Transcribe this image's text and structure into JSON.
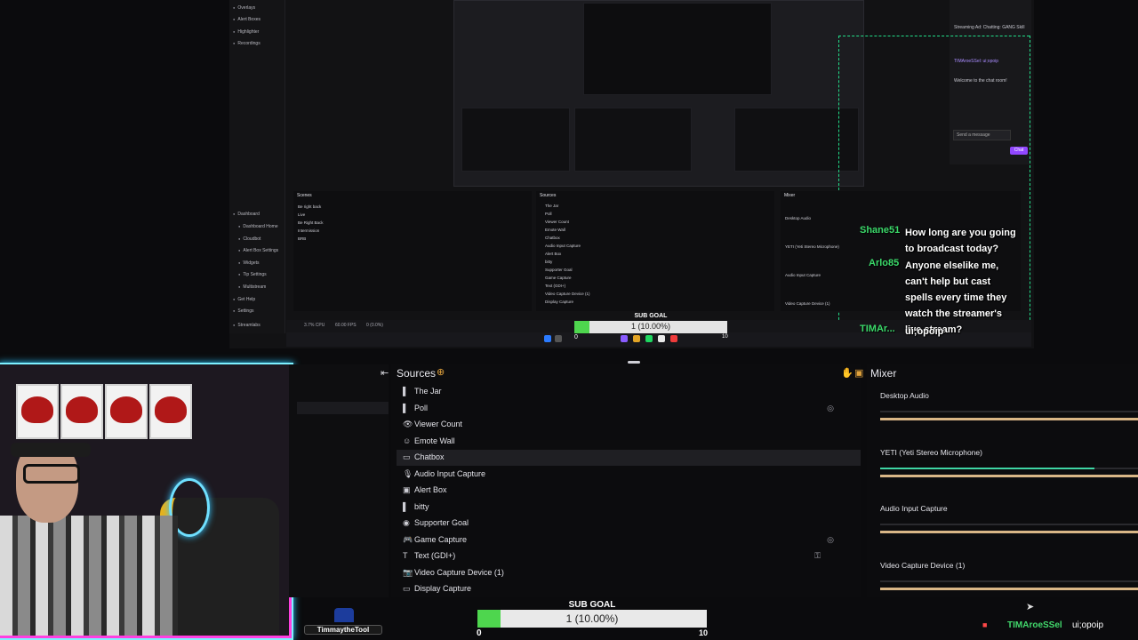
{
  "preview": {
    "sidebar_items": [
      "Overlays",
      "Alert Boxes",
      "Highlighter",
      "Recordings",
      "Dashboard",
      "Dashboard Home",
      "Cloudbot",
      "Alert Box Settings",
      "Widgets",
      "Tip Settings",
      "Multistream",
      "Get Help",
      "Settings",
      "Streamlabs"
    ],
    "mini_scenes_title": "Scenes",
    "mini_scenes": [
      "Be right back",
      "Live",
      "Be Right Back",
      "Intermission",
      "BRB"
    ],
    "mini_sources_title": "Sources",
    "mini_sources": [
      "The Jar",
      "Poll",
      "Viewer Count",
      "Emote Wall",
      "Chatbox",
      "Audio Input Capture",
      "Alert Box",
      "bitty",
      "Supporter Goal",
      "Game Capture",
      "Text (GDI+)",
      "Video Capture Device (1)",
      "Display Capture"
    ],
    "mini_mixer_title": "Mixer",
    "mini_mixer": [
      "Desktop Audio",
      "YETI (Yeti Stereo Microphone)",
      "Audio Input Capture",
      "Video Capture Device (1)"
    ],
    "status": {
      "cpu": "3.7% CPU",
      "fps": "60.00 FPS",
      "kb": "0 (0.0%)"
    },
    "chat_overlay": [
      {
        "user": "Shane51",
        "text": "How long are you going to broadcast today?"
      },
      {
        "user": "Arlo85",
        "text": "Anyone elselike me, can't help but cast spells every time they watch the streamer's live stream?"
      },
      {
        "user": "TIMAr...",
        "text": "ui;opoip"
      }
    ],
    "twitch_chat": {
      "messages": [
        "Streaming Ad: Chatting: GANG Skill",
        "TIMAroeSSel: ui;opoip",
        "Welcome to the chat room!"
      ],
      "input_placeholder": "Send a message",
      "chat_button": "Chat"
    },
    "goal": {
      "title": "SUB GOAL",
      "text": "1 (10.00%)",
      "min": "0",
      "max": "10"
    }
  },
  "sources_panel": {
    "title": "Sources",
    "items": [
      {
        "label": "The Jar",
        "icon": "jar-icon",
        "glyph": "▌"
      },
      {
        "label": "Poll",
        "icon": "poll-icon",
        "glyph": "▌",
        "eye": true
      },
      {
        "label": "Viewer Count",
        "icon": "viewer-count-icon",
        "glyph": "👁"
      },
      {
        "label": "Emote Wall",
        "icon": "emote-wall-icon",
        "glyph": "☺"
      },
      {
        "label": "Chatbox",
        "icon": "chatbox-icon",
        "glyph": "▭",
        "selected": true
      },
      {
        "label": "Audio Input Capture",
        "icon": "mic-icon",
        "glyph": "🎙"
      },
      {
        "label": "Alert Box",
        "icon": "alert-icon",
        "glyph": "▣"
      },
      {
        "label": "bitty",
        "icon": "widget-icon",
        "glyph": "▌"
      },
      {
        "label": "Supporter Goal",
        "icon": "goal-icon",
        "glyph": "◉"
      },
      {
        "label": "Game Capture",
        "icon": "gamepad-icon",
        "glyph": "🎮",
        "eye": true
      },
      {
        "label": "Text (GDI+)",
        "icon": "text-icon",
        "glyph": "T",
        "lock": true
      },
      {
        "label": "Video Capture Device (1)",
        "icon": "camera-icon",
        "glyph": "📷"
      },
      {
        "label": "Display Capture",
        "icon": "monitor-icon",
        "glyph": "▭"
      }
    ]
  },
  "mixer_panel": {
    "title": "Mixer",
    "channels": [
      {
        "label": "Desktop Audio",
        "level": 0.0
      },
      {
        "label": "YETI (Yeti Stereo Microphone)",
        "level": 0.83
      },
      {
        "label": "Audio Input Capture",
        "level": 0.0
      },
      {
        "label": "Video Capture Device (1)",
        "level": 0.0
      }
    ]
  },
  "sub_goal": {
    "title": "SUB GOAL",
    "text": "1 (10.00%)",
    "progress": 0.1,
    "min": "0",
    "max": "10"
  },
  "branding": {
    "name": "TimmaytheTool"
  },
  "ticker": {
    "user": "TIMAroeSSel",
    "message": "ui;opoip"
  },
  "colors": {
    "accent_green": "#4ed64e",
    "neon_cyan": "#29c8ff",
    "neon_pink": "#ff3fe0",
    "chat_user": "#3bd96a",
    "mixer_track": "#d9b686"
  }
}
